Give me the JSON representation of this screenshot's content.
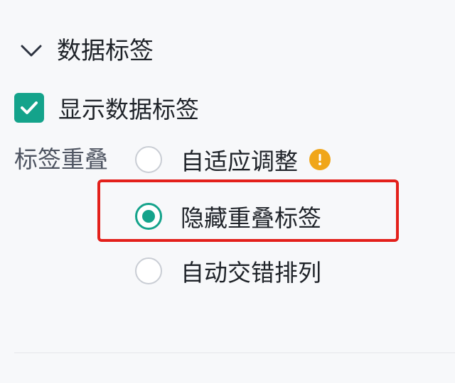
{
  "section": {
    "title": "数据标签",
    "toggle_icon": "chevron-down-icon"
  },
  "show_labels": {
    "label": "显示数据标签",
    "checked": true,
    "icon": "checkmark-icon"
  },
  "label_overlap": {
    "label": "标签重叠",
    "options": [
      {
        "label": "自适应调整",
        "selected": false,
        "icon": "warning-icon"
      },
      {
        "label": "隐藏重叠标签",
        "selected": true
      },
      {
        "label": "自动交错排列",
        "selected": false
      }
    ]
  },
  "colors": {
    "accent": "#14a38b",
    "warning": "#f0a61a",
    "highlight": "#e3201b"
  }
}
